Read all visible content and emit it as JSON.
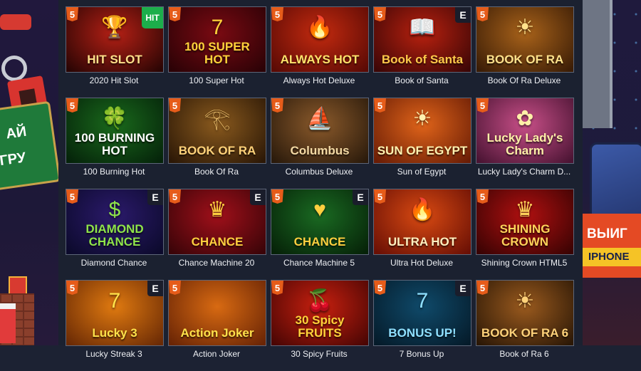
{
  "side_left": {
    "banner_text_1": "АЙ",
    "banner_text_2": "ГРУ"
  },
  "side_right": {
    "banner_text_1": "ВЫИГ",
    "banner_text_2": "IPHONE"
  },
  "badges": {
    "html5": "5",
    "provider": "E",
    "hit": "HIT"
  },
  "games": [
    {
      "name": "2020 Hit Slot",
      "art": "HIT SLOT",
      "glyph": "🏆",
      "bg": "#b52015",
      "bg2": "#2a0504",
      "color": "#ffe08a",
      "provider": false,
      "hit": true
    },
    {
      "name": "100 Super Hot",
      "art": "100 SUPER HOT",
      "glyph": "7",
      "bg": "#7a0a12",
      "bg2": "#2b0206",
      "color": "#ffd23a",
      "provider": false,
      "hit": false
    },
    {
      "name": "Always Hot Deluxe",
      "art": "ALWAYS HOT",
      "glyph": "🔥",
      "bg": "#c32a0f",
      "bg2": "#5a0a05",
      "color": "#ffe36b",
      "provider": false,
      "hit": false
    },
    {
      "name": "Book of Santa",
      "art": "Book of Santa",
      "glyph": "📖",
      "bg": "#b8210f",
      "bg2": "#3c0606",
      "color": "#ffc94a",
      "provider": true,
      "hit": false
    },
    {
      "name": "Book Of Ra Deluxe",
      "art": "BOOK OF RA",
      "glyph": "☀",
      "bg": "#a8621a",
      "bg2": "#3b1d06",
      "color": "#ffe28c",
      "provider": false,
      "hit": false
    },
    {
      "name": "100 Burning Hot",
      "art": "100 BURNING HOT",
      "glyph": "🍀",
      "bg": "#1a6a1c",
      "bg2": "#05230a",
      "color": "#ffffff",
      "provider": false,
      "hit": false
    },
    {
      "name": "Book Of Ra",
      "art": "BOOK OF RA",
      "glyph": "𓂀",
      "bg": "#8a5a1e",
      "bg2": "#2c1806",
      "color": "#ffd27a",
      "provider": false,
      "hit": false
    },
    {
      "name": "Columbus Deluxe",
      "art": "Columbus",
      "glyph": "⛵",
      "bg": "#8b5a2b",
      "bg2": "#2a1a0b",
      "color": "#f3d9a4",
      "provider": false,
      "hit": false
    },
    {
      "name": "Sun of Egypt",
      "art": "SUN OF EGYPT",
      "glyph": "☀",
      "bg": "#e0641a",
      "bg2": "#6a1d05",
      "color": "#fff2b0",
      "provider": false,
      "hit": false
    },
    {
      "name": "Lucky Lady's Charm D...",
      "art": "Lucky Lady's Charm",
      "glyph": "✿",
      "bg": "#c84f88",
      "bg2": "#4a1433",
      "color": "#fff0a8",
      "provider": false,
      "hit": false
    },
    {
      "name": "Diamond Chance",
      "art": "DIAMOND CHANCE",
      "glyph": "$",
      "bg": "#2b1a6b",
      "bg2": "#0c0a2c",
      "color": "#8fe44a",
      "provider": true,
      "hit": false
    },
    {
      "name": "Chance Machine 20",
      "art": "CHANCE",
      "glyph": "♛",
      "bg": "#a0101a",
      "bg2": "#3a0408",
      "color": "#ffcf3f",
      "provider": true,
      "hit": false
    },
    {
      "name": "Chance Machine 5",
      "art": "CHANCE",
      "glyph": "♥",
      "bg": "#1a6a22",
      "bg2": "#062208",
      "color": "#ffcf3f",
      "provider": true,
      "hit": false
    },
    {
      "name": "Ultra Hot Deluxe",
      "art": "ULTRA HOT",
      "glyph": "🔥",
      "bg": "#d94a12",
      "bg2": "#6a1005",
      "color": "#fff0c0",
      "provider": false,
      "hit": false
    },
    {
      "name": "Shining Crown HTML5",
      "art": "SHINING CROWN",
      "glyph": "♛",
      "bg": "#b01010",
      "bg2": "#3a0303",
      "color": "#ffd35a",
      "provider": false,
      "hit": false
    },
    {
      "name": "Lucky Streak 3",
      "art": "Lucky 3",
      "glyph": "7",
      "bg": "#e07a10",
      "bg2": "#6a2a05",
      "color": "#ffe24a",
      "provider": true,
      "hit": false
    },
    {
      "name": "Action Joker",
      "art": "Action Joker",
      "glyph": "",
      "bg": "#d86a12",
      "bg2": "#6a2505",
      "color": "#ffe14a",
      "provider": false,
      "hit": false
    },
    {
      "name": "30 Spicy Fruits",
      "art": "30 Spicy FRUITS",
      "glyph": "🍒",
      "bg": "#c8200f",
      "bg2": "#4a0604",
      "color": "#ffd23a",
      "provider": false,
      "hit": false
    },
    {
      "name": "7 Bonus Up",
      "art": "BONUS UP!",
      "glyph": "7",
      "bg": "#0f4a6a",
      "bg2": "#051b2a",
      "color": "#8fe0ff",
      "provider": true,
      "hit": false
    },
    {
      "name": "Book of Ra 6",
      "art": "BOOK OF RA 6",
      "glyph": "☀",
      "bg": "#9a5a1e",
      "bg2": "#2c1806",
      "color": "#ffd27a",
      "provider": false,
      "hit": false
    }
  ]
}
